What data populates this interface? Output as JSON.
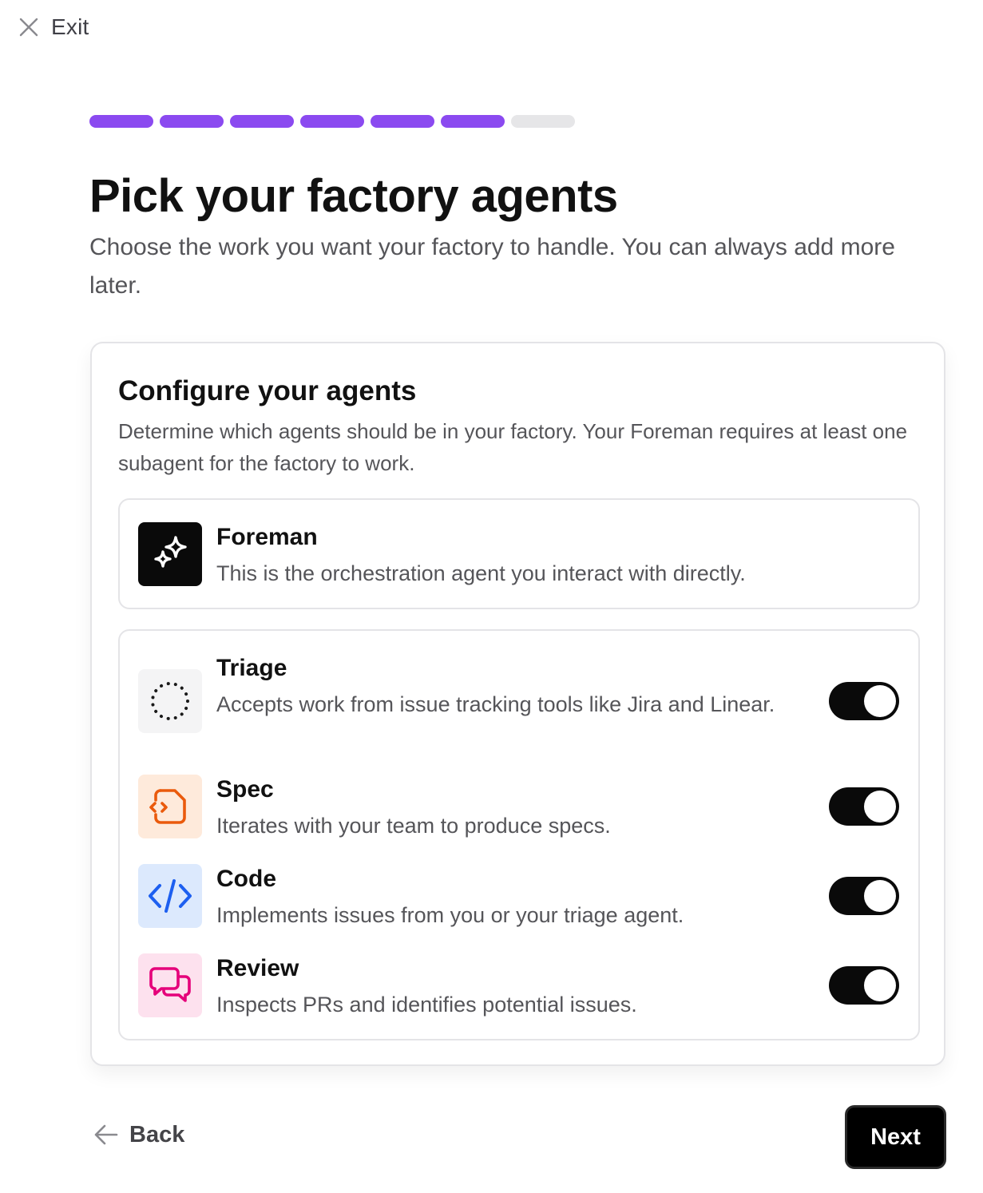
{
  "header": {
    "exit_label": "Exit"
  },
  "progress": {
    "total_steps": 7,
    "completed_steps": 6,
    "accent_color": "#8b4af0"
  },
  "page": {
    "title": "Pick your factory agents",
    "subtitle": "Choose the work you want your factory to handle. You can always add more later."
  },
  "card": {
    "title": "Configure your agents",
    "description": "Determine which agents should be in your factory. Your Foreman requires at least one subagent for the factory to work."
  },
  "foreman": {
    "name": "Foreman",
    "description": "This is the orchestration agent you interact with directly.",
    "icon": "sparkles-icon"
  },
  "agents": [
    {
      "name": "Triage",
      "description": "Accepts work from issue tracking tools like Jira and Linear.",
      "icon": "dotted-circle-icon",
      "enabled": true
    },
    {
      "name": "Spec",
      "description": "Iterates with your team to produce specs.",
      "icon": "code-file-icon",
      "enabled": true
    },
    {
      "name": "Code",
      "description": "Implements issues from you or your triage agent.",
      "icon": "code-brackets-icon",
      "enabled": true
    },
    {
      "name": "Review",
      "description": "Inspects PRs and identifies potential issues.",
      "icon": "chat-bubbles-icon",
      "enabled": true
    }
  ],
  "footer": {
    "back_label": "Back",
    "next_label": "Next"
  }
}
